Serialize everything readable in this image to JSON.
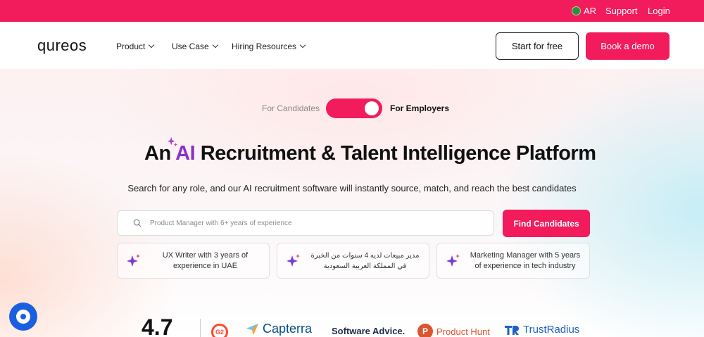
{
  "topbar": {
    "lang": "AR",
    "support": "Support",
    "login": "Login"
  },
  "nav": {
    "logo": "qureos",
    "items": [
      {
        "label": "Product"
      },
      {
        "label": "Use Case"
      },
      {
        "label": "Hiring Resources"
      }
    ],
    "start_free": "Start for free",
    "book_demo": "Book a demo"
  },
  "hero": {
    "toggle_left": "For Candidates",
    "toggle_right": "For Employers",
    "headline_pre": "An ",
    "headline_ai": "AI",
    "headline_post": " Recruitment & Talent Intelligence Platform",
    "subtitle": "Search for any role, and our AI recruitment software will instantly source, match, and reach the best candidates",
    "search_placeholder": "Product Manager with 6+ years of experience",
    "find_button": "Find Candidates",
    "suggestions": [
      {
        "text": "UX Writer with 3 years of experience in UAE"
      },
      {
        "text": "مدير مبيعات لديه 4 سنوات من الخبرة في المملكة العربية السعودية"
      },
      {
        "text": "Marketing Manager with 5 years of experience in tech industry"
      }
    ]
  },
  "reviews": {
    "rating": "4.7",
    "brands": {
      "g2": "G2",
      "capterra": "Capterra",
      "software_advice": "Software Advice.",
      "product_hunt": "Product Hunt",
      "product_hunt_letter": "P",
      "trustradius": "TrustRadius"
    }
  },
  "colors": {
    "brand": "#f21b5b",
    "ai_accent": "#8b2fc9",
    "chat": "#1a5fe0"
  }
}
